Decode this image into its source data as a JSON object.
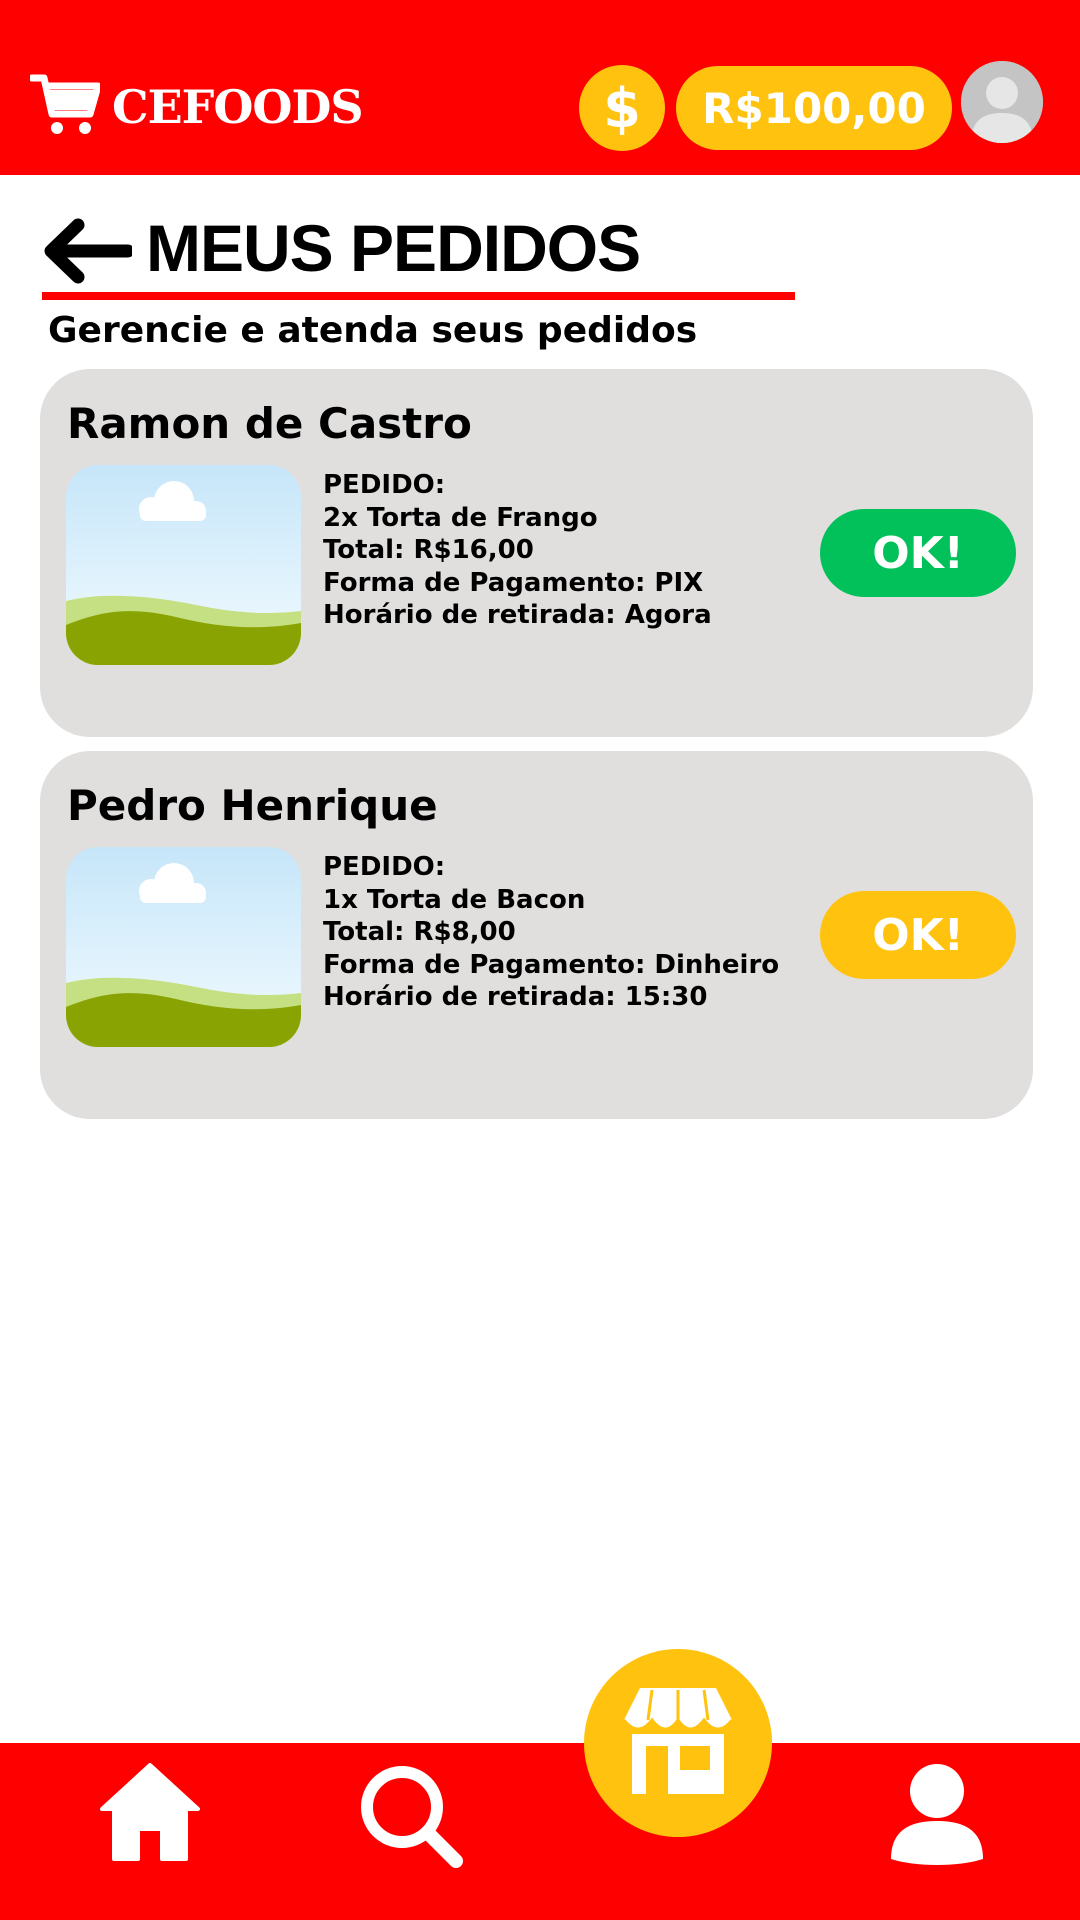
{
  "header": {
    "app_name": "CEFOODS",
    "coin_symbol": "$",
    "balance": "R$100,00"
  },
  "page": {
    "title": "MEUS PEDIDOS",
    "subtitle": "Gerencie e atenda seus pedidos"
  },
  "orders": [
    {
      "customer": "Ramon de Castro",
      "lines": [
        "PEDIDO:",
        "2x Torta de Frango",
        "Total: R$16,00",
        "Forma de Pagamento: PIX",
        "Horário de retirada: Agora"
      ],
      "button_label": "OK!",
      "button_color": "#02c05a"
    },
    {
      "customer": "Pedro Henrique",
      "lines": [
        "PEDIDO:",
        "1x Torta de Bacon",
        "Total: R$8,00",
        "Forma de Pagamento: Dinheiro",
        "Horário de retirada: 15:30"
      ],
      "button_label": "OK!",
      "button_color": "#ffc20e"
    }
  ],
  "bottom_nav": {
    "items": [
      "home-icon",
      "search-icon",
      "store-icon",
      "user-icon"
    ]
  },
  "colors": {
    "brand_red": "#ff0000",
    "accent_yellow": "#ffc20e",
    "card_bg": "#e1dfde",
    "success_green": "#02c05a"
  }
}
